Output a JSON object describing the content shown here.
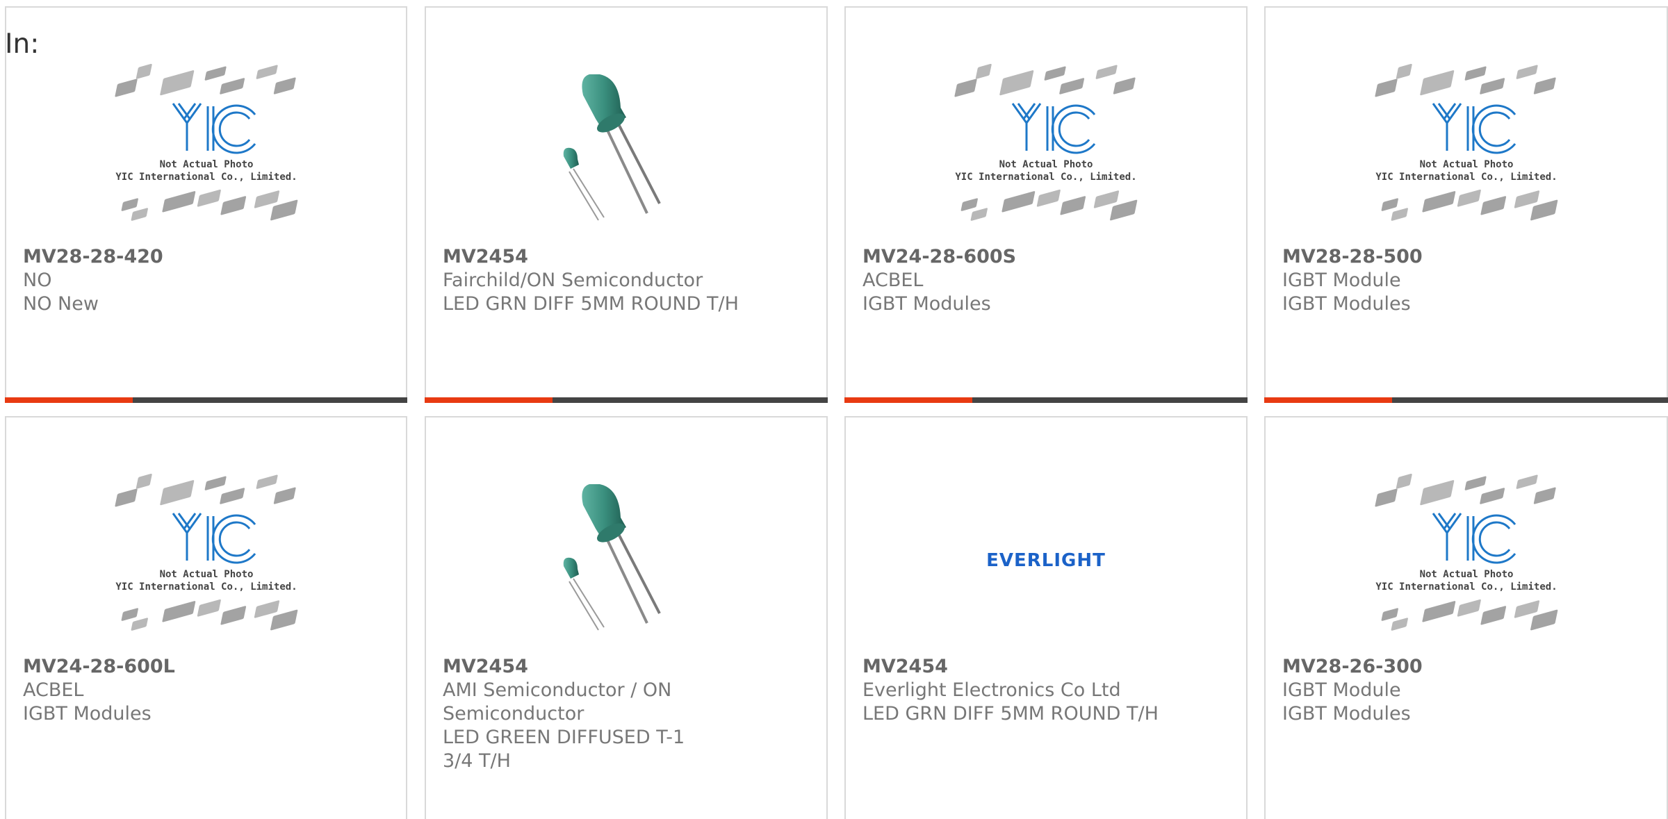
{
  "header": {
    "in_label": "In:"
  },
  "placeholder_image": {
    "line1": "Not Actual Photo",
    "line2": "YIC International Co., Limited."
  },
  "brand_logo": "EVERLIGHT",
  "colors": {
    "accent": "#e83a12",
    "bar_dark": "#444444",
    "led_green": "#3a8f7e",
    "logo_blue": "#1e78c8"
  },
  "products": [
    {
      "image": "placeholder",
      "part_number": "MV28-28-420",
      "manufacturer": "NO",
      "description": "NO New"
    },
    {
      "image": "led",
      "part_number": "MV2454",
      "manufacturer": "Fairchild/ON Semiconductor",
      "description": "LED GRN DIFF 5MM ROUND T/H"
    },
    {
      "image": "placeholder",
      "part_number": "MV24-28-600S",
      "manufacturer": "ACBEL",
      "description": "IGBT Modules"
    },
    {
      "image": "placeholder",
      "part_number": "MV28-28-500",
      "manufacturer": "IGBT Module",
      "description": "IGBT Modules"
    },
    {
      "image": "placeholder",
      "part_number": "MV24-28-600L",
      "manufacturer": "ACBEL",
      "description": "IGBT Modules"
    },
    {
      "image": "led",
      "part_number": "MV2454",
      "manufacturer": "AMI Semiconductor / ON Semiconductor",
      "description": "LED GREEN DIFFUSED T-1 3/4 T/H"
    },
    {
      "image": "brand",
      "part_number": "MV2454",
      "manufacturer": "Everlight Electronics Co Ltd",
      "description": "LED GRN DIFF 5MM ROUND T/H"
    },
    {
      "image": "placeholder",
      "part_number": "MV28-26-300",
      "manufacturer": "IGBT Module",
      "description": "IGBT Modules"
    }
  ]
}
